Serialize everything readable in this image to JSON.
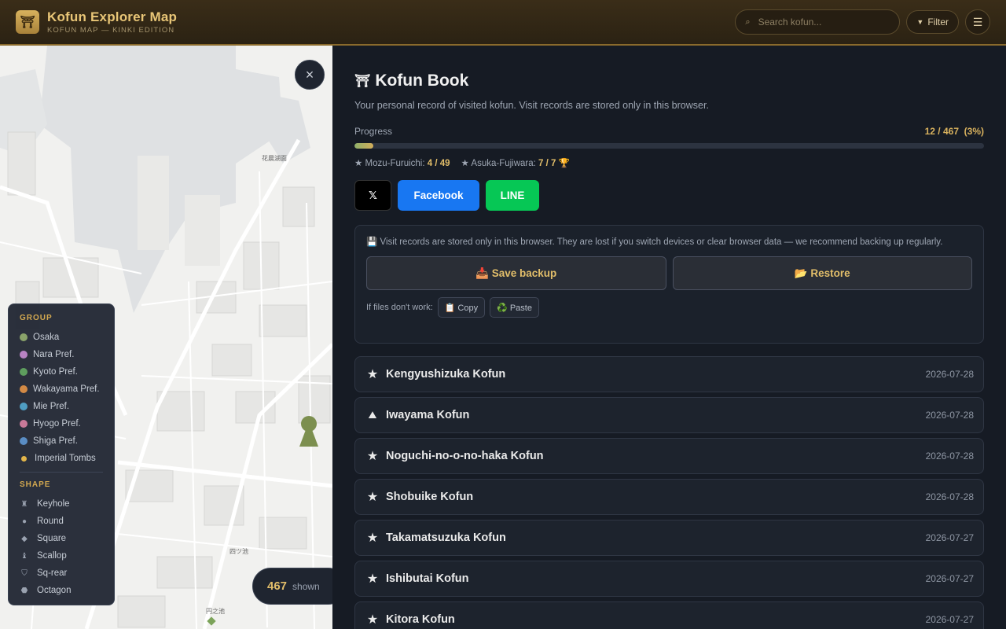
{
  "header": {
    "logo_glyph": "⛩",
    "title": "Kofun Explorer Map",
    "subtitle": "KOFUN MAP — KINKI EDITION",
    "search_placeholder": "Search kofun...",
    "search_icon": "⌕",
    "filter_label": "Filter",
    "filter_icon": "▼",
    "menu_icon": "☰"
  },
  "map": {
    "close_icon": "×",
    "labels": [
      "花晨湖面",
      "四ツ池",
      "円之池"
    ],
    "shown_count": "467",
    "shown_label": "shown",
    "legend": {
      "group_heading": "GROUP",
      "groups": [
        {
          "label": "Osaka",
          "color": "#8aa36a"
        },
        {
          "label": "Nara Pref.",
          "color": "#b883c4"
        },
        {
          "label": "Kyoto Pref.",
          "color": "#5e9e5e"
        },
        {
          "label": "Wakayama Pref.",
          "color": "#d38a45"
        },
        {
          "label": "Mie Pref.",
          "color": "#4f9dc2"
        },
        {
          "label": "Hyogo Pref.",
          "color": "#c97a99"
        },
        {
          "label": "Shiga Pref.",
          "color": "#5a8dc4"
        },
        {
          "label": "Imperial Tombs",
          "color": "#e2b54a"
        }
      ],
      "shape_heading": "SHAPE",
      "shapes": [
        {
          "label": "Keyhole",
          "glyph": "♜"
        },
        {
          "label": "Round",
          "glyph": "●"
        },
        {
          "label": "Square",
          "glyph": "◆"
        },
        {
          "label": "Scallop",
          "glyph": "♝"
        },
        {
          "label": "Sq-rear",
          "glyph": "⛉"
        },
        {
          "label": "Octagon",
          "glyph": "⬣"
        }
      ]
    }
  },
  "panel": {
    "title_icon": "⛩",
    "title": "Kofun Book",
    "description": "Your personal record of visited kofun. Visit records are stored only in this browser.",
    "progress_label": "Progress",
    "progress_value": "12 / 467  (3%)",
    "progress_fraction": 0.03,
    "stats": [
      {
        "label": "★ Mozu-Furuichi: ",
        "value": "4 / 49"
      },
      {
        "label": "★ Asuka-Fujiwara: ",
        "value": "7 / 7 🏆"
      }
    ],
    "share": {
      "x": "𝕏",
      "facebook": "Facebook",
      "line": "LINE"
    },
    "backup": {
      "note": "💾  Visit records are stored only in this browser. They are lost if you switch devices or clear browser data — we recommend backing up regularly.",
      "save_label": "📥  Save backup",
      "restore_label": "📂  Restore",
      "alt_label": "If files don't work:",
      "copy_label": "📋 Copy",
      "paste_label": "♻️ Paste"
    },
    "items": [
      {
        "icon": "★",
        "name": "Kengyushizuka Kofun",
        "date": "2026-07-28"
      },
      {
        "icon": "⛰",
        "name": "Iwayama Kofun",
        "date": "2026-07-28"
      },
      {
        "icon": "★",
        "name": "Noguchi-no-o-no-haka Kofun",
        "date": "2026-07-28"
      },
      {
        "icon": "★",
        "name": "Shobuike Kofun",
        "date": "2026-07-28"
      },
      {
        "icon": "★",
        "name": "Takamatsuzuka Kofun",
        "date": "2026-07-27"
      },
      {
        "icon": "★",
        "name": "Ishibutai Kofun",
        "date": "2026-07-27"
      },
      {
        "icon": "★",
        "name": "Kitora Kofun",
        "date": "2026-07-27"
      }
    ]
  }
}
